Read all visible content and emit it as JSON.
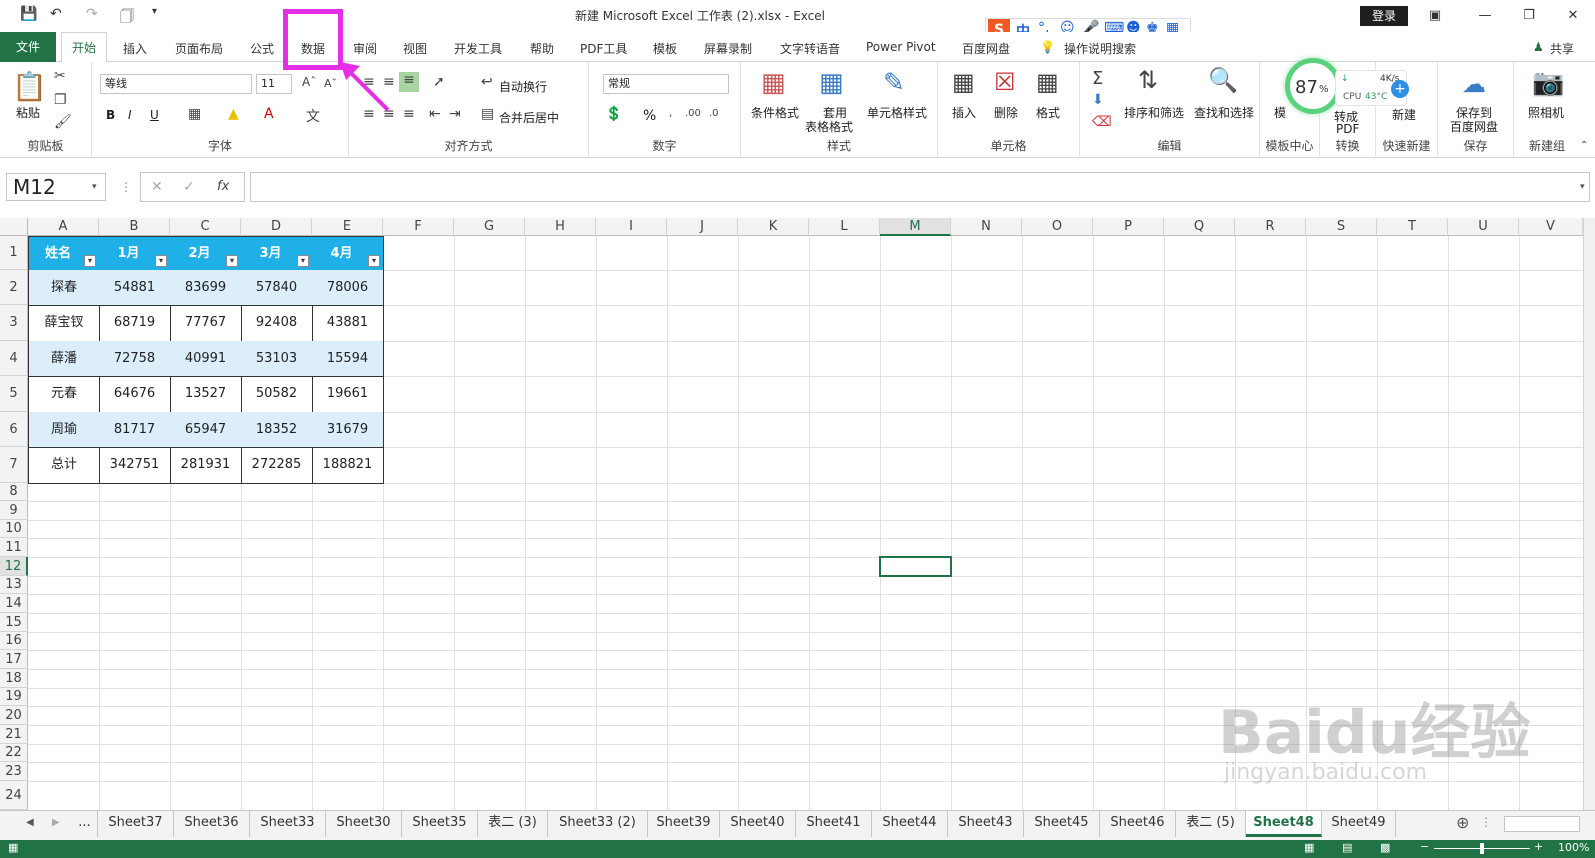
{
  "window": {
    "title": "新建 Microsoft Excel 工作表 (2).xlsx  -  Excel",
    "login": "登录"
  },
  "tabs": [
    "文件",
    "开始",
    "插入",
    "页面布局",
    "公式",
    "数据",
    "审阅",
    "视图",
    "开发工具",
    "帮助",
    "PDF工具",
    "模板",
    "屏幕录制",
    "文字转语音",
    "Power Pivot",
    "百度网盘"
  ],
  "search_hint": "操作说明搜索",
  "share": "共享",
  "ime": "中",
  "ribbon": {
    "clipboard": {
      "label": "剪贴板",
      "paste": "粘贴"
    },
    "font": {
      "label": "字体",
      "name": "等线",
      "size": "11",
      "bold": "B",
      "italic": "I",
      "underline": "U"
    },
    "align": {
      "label": "对齐方式",
      "wrap": "自动换行",
      "merge": "合并后居中"
    },
    "number": {
      "label": "数字",
      "format": "常规",
      "percent": "%"
    },
    "styles": {
      "label": "样式",
      "cond": "条件格式",
      "table1": "套用",
      "table2": "表格格式",
      "cell": "单元格样式"
    },
    "cells": {
      "label": "单元格",
      "insert": "插入",
      "delete": "删除",
      "format": "格式"
    },
    "edit": {
      "label": "编辑",
      "sort": "排序和筛选",
      "find": "查找和选择"
    },
    "template": {
      "label": "模板中心",
      "short": "模"
    },
    "convert": {
      "label": "转换",
      "pdf1": "转成",
      "pdf2": "PDF"
    },
    "quick": {
      "label": "快速新建",
      "new": "新建"
    },
    "save": {
      "label": "保存",
      "btn1": "保存到",
      "btn2": "百度网盘"
    },
    "newgroup": {
      "label": "新建组",
      "camera": "照相机"
    }
  },
  "widget": {
    "percent": "87",
    "pct_sign": "%",
    "speed": "4K/s",
    "cpu": "CPU",
    "temp": "43°C"
  },
  "formula_bar": {
    "name_box": "M12",
    "fx": "fx",
    "formula": ""
  },
  "columns": [
    "A",
    "B",
    "C",
    "D",
    "E",
    "F",
    "G",
    "H",
    "I",
    "J",
    "K",
    "L",
    "M",
    "N",
    "O",
    "P",
    "Q",
    "R",
    "S",
    "T",
    "U",
    "V"
  ],
  "rows": [
    "1",
    "2",
    "3",
    "4",
    "5",
    "6",
    "7",
    "8",
    "9",
    "10",
    "11",
    "12",
    "13",
    "14",
    "15",
    "16",
    "17",
    "18",
    "19",
    "20",
    "21",
    "22",
    "23",
    "24"
  ],
  "table": {
    "headers": [
      "姓名",
      "1月",
      "2月",
      "3月",
      "4月"
    ],
    "rows": [
      [
        "探春",
        "54881",
        "83699",
        "57840",
        "78006"
      ],
      [
        "薛宝钗",
        "68719",
        "77767",
        "92408",
        "43881"
      ],
      [
        "薛潘",
        "72758",
        "40991",
        "53103",
        "15594"
      ],
      [
        "元春",
        "64676",
        "13527",
        "50582",
        "19661"
      ],
      [
        "周瑜",
        "81717",
        "65947",
        "18352",
        "31679"
      ],
      [
        "总计",
        "342751",
        "281931",
        "272285",
        "188821"
      ]
    ]
  },
  "sheets": [
    "...",
    "Sheet37",
    "Sheet36",
    "Sheet33",
    "Sheet30",
    "Sheet35",
    "表二 (3)",
    "Sheet33 (2)",
    "Sheet39",
    "Sheet40",
    "Sheet41",
    "Sheet44",
    "Sheet43",
    "Sheet45",
    "Sheet46",
    "表二 (5)",
    "Sheet48",
    "Sheet49"
  ],
  "active_sheet": "Sheet48",
  "status": {
    "zoom": "100%"
  },
  "watermark": {
    "main": "Baidu经验",
    "sub": "jingyan.baidu.com"
  },
  "colors": {
    "excel_green": "#217346",
    "header_blue": "#1fb0e8",
    "band": "#dbeefa",
    "highlight": "#e52ee5"
  }
}
